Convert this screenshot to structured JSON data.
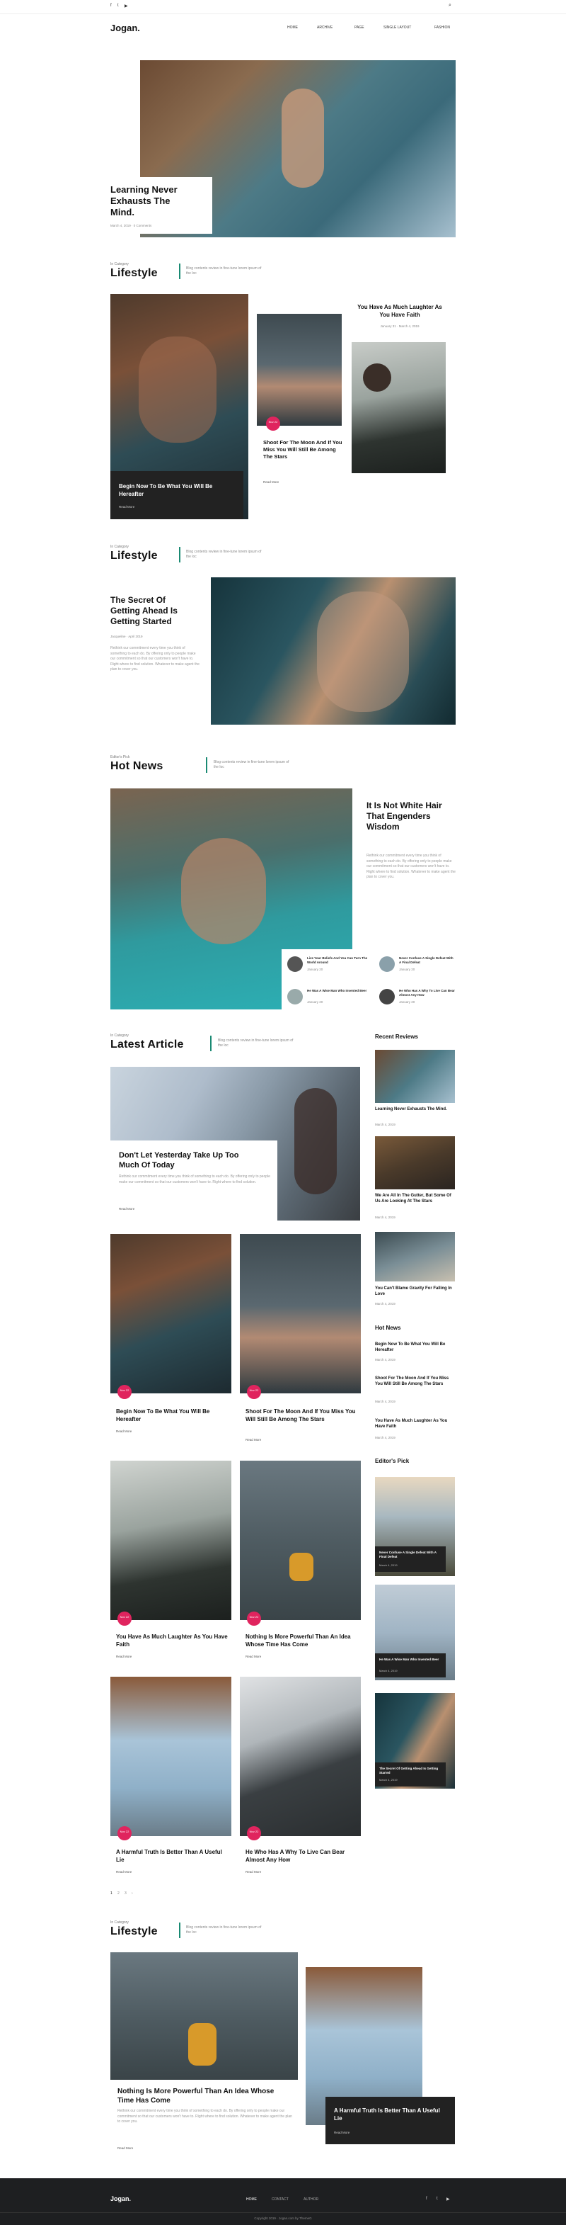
{
  "header": {
    "logo": "Jogan.",
    "social": [
      "facebook-icon",
      "twitter-icon",
      "youtube-icon"
    ],
    "nav": [
      "HOME",
      "ARCHIVE",
      "PAGE",
      "SINGLE LAYOUT",
      "FASHION"
    ]
  },
  "hero": {
    "title": "Learning Never Exhausts The Mind.",
    "meta": "March 4, 2019 · 0 Comments"
  },
  "lifestyle1": {
    "eyebrow": "In Category",
    "title": "Lifestyle",
    "desc": "Blog contents review in fine-tune lorem ipsum of the loc",
    "main_title": "Begin Now To Be What You Will Be Hereafter",
    "main_read": "Read More",
    "mid_badge": "Nov 22",
    "mid_title": "Shoot For The Moon And If You Miss You Will Still Be Among The Stars",
    "mid_read": "Read More",
    "right_title": "You Have As Much Laughter As You Have Faith",
    "right_meta": "January 31 · March 4, 2019"
  },
  "lifestyle2": {
    "eyebrow": "In Category",
    "title": "Lifestyle",
    "desc": "Blog contents review in fine-tune lorem ipsum of the loc",
    "post_title": "The Secret Of Getting Ahead Is Getting Started",
    "post_meta": "Jacqueline · April 2019",
    "post_text": "Rethink our commitment every time you think of something to each do. By offering only to people make our commitment so that our customers won't have to. Right where to find solution. Whatever to make agent the plan to cover you."
  },
  "hotnews": {
    "eyebrow": "Editor's Pick",
    "title": "Hot News",
    "desc": "Blog contents review in fine-tune lorem ipsum of the loc",
    "feature_title": "It Is Not White Hair That Engenders Wisdom",
    "feature_text": "Rethink our commitment every time you think of something to each do. By offering only to people make our commitment so that our customers won't have to. Right where to find solution. Whatever to make agent the plan to cover you.",
    "small": [
      {
        "title": "Live Your Beliefs And You Can Turn The World Around",
        "meta": "January 20"
      },
      {
        "title": "Never Confuse A Single Defeat With A Final Defeat",
        "meta": "January 20"
      },
      {
        "title": "He Was A Wise Man Who Invented Beer",
        "meta": "January 20"
      },
      {
        "title": "He Who Has A Why To Live Can Bear Almost Any How",
        "meta": "January 20"
      }
    ]
  },
  "latest": {
    "eyebrow": "In Category",
    "title": "Latest Article",
    "desc": "Blog contents review in fine-tune lorem ipsum of the loc",
    "feature_title": "Don't Let Yesterday Take Up Too Much Of Today",
    "feature_text": "Rethink our commitment every time you think of something to each do. By offering only to people make our commitment so that our customers won't have to. Right where to find solution.",
    "feature_read": "Read More",
    "cards": [
      {
        "title": "Begin Now To Be What You Will Be Hereafter",
        "badge": "Nov 22",
        "read": "Read More"
      },
      {
        "title": "Shoot For The Moon And If You Miss You Will Still Be Among The Stars",
        "badge": "Nov 22",
        "read": "Read More"
      },
      {
        "title": "You Have As Much Laughter As You Have Faith",
        "badge": "Nov 22",
        "read": "Read More"
      },
      {
        "title": "Nothing Is More Powerful Than An Idea Whose Time Has Come",
        "badge": "Nov 22",
        "read": "Read More"
      },
      {
        "title": "A Harmful Truth Is Better Than A Useful Lie",
        "badge": "Nov 22",
        "read": "Read More"
      },
      {
        "title": "He Who Has A Why To Live Can Bear Almost Any How",
        "badge": "Nov 22",
        "read": "Read More"
      }
    ],
    "pagination": [
      "1",
      "2",
      "3",
      "›"
    ]
  },
  "sidebar": {
    "recent_title": "Recent Reviews",
    "recent": [
      {
        "title": "Learning Never Exhausts The Mind.",
        "meta": "March 4, 2019"
      },
      {
        "title": "We Are All In The Gutter, But Some Of Us Are Looking At The Stars",
        "meta": "March 4, 2019"
      },
      {
        "title": "You Can't Blame Gravity For Falling In Love",
        "meta": "March 4, 2019"
      }
    ],
    "hot_title": "Hot News",
    "hot": [
      {
        "title": "Begin Now To Be What You Will Be Hereafter",
        "meta": "March 4, 2019"
      },
      {
        "title": "Shoot For The Moon And If You Miss You Will Still Be Among The Stars",
        "meta": "March 4, 2019"
      },
      {
        "title": "You Have As Much Laughter As You Have Faith",
        "meta": "March 4, 2019"
      }
    ],
    "pick_title": "Editor's Pick",
    "pick": [
      {
        "title": "Never Confuse A Single Defeat With A Final Defeat",
        "meta": "March 4, 2019"
      },
      {
        "title": "He Was A Wise Man Who Invented Beer",
        "meta": "March 4, 2019"
      },
      {
        "title": "The Secret Of Getting Ahead Is Getting Started",
        "meta": "March 4, 2019"
      }
    ]
  },
  "lifestyle3": {
    "eyebrow": "In Category",
    "title": "Lifestyle",
    "desc": "Blog contents review in fine-tune lorem ipsum of the loc",
    "main_title": "Nothing Is More Powerful Than An Idea Whose Time Has Come",
    "main_text": "Rethink our commitment every time you think of something to each do. By offering only to people make our commitment so that our customers won't have to. Right where to find solution. Whatever to make agent the plan to cover you.",
    "main_read": "Read More",
    "right_title": "A Harmful Truth Is Better Than A Useful Lie",
    "right_read": "Read More"
  },
  "footer": {
    "logo": "Jogan.",
    "links": [
      "HOME",
      "CONTACT",
      "AUTHOR"
    ],
    "social": [
      "facebook-icon",
      "twitter-icon",
      "youtube-icon"
    ],
    "copyright": "Copyright 2019 · Jogan.com by ThemeG"
  }
}
